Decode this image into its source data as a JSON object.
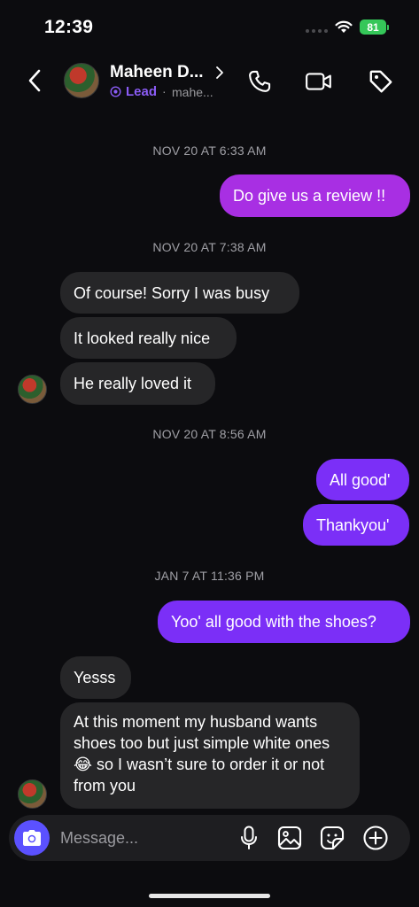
{
  "status_bar": {
    "time": "12:39",
    "battery": "81"
  },
  "header": {
    "contact_name": "Maheen D...",
    "lead_label": "Lead",
    "separator": "·",
    "username": "mahe..."
  },
  "conversation": {
    "timestamps": [
      "NOV 20 AT 6:33 AM",
      "NOV 20 AT 7:38 AM",
      "NOV 20 AT 8:56 AM",
      "JAN 7 AT 11:36 PM"
    ],
    "messages": [
      {
        "sender": "me",
        "text": "Do give us a review !!"
      },
      {
        "sender": "them",
        "text": "Of course! Sorry I was busy"
      },
      {
        "sender": "them",
        "text": "It looked really nice"
      },
      {
        "sender": "them",
        "text": "He really loved it"
      },
      {
        "sender": "me",
        "text": "All good'"
      },
      {
        "sender": "me",
        "text": "Thankyou'"
      },
      {
        "sender": "me",
        "text": "Yoo' all good with the shoes?"
      },
      {
        "sender": "them",
        "text": "Yesss"
      },
      {
        "sender": "them",
        "text": "At this moment my husband wants shoes too but just simple white ones😂 so I wasn’t sure to order it or not from you"
      }
    ]
  },
  "composer": {
    "placeholder": "Message..."
  },
  "colors": {
    "background": "#0c0c0f",
    "outgoing_bubble": "#7b2ff7",
    "outgoing_bubble_first": "#a82fe3",
    "incoming_bubble": "#262628",
    "camera_button": "#5b51ff",
    "lead_accent": "#8b5cf6",
    "battery": "#35c759"
  },
  "icons": [
    "signal-icon",
    "wifi-icon",
    "battery-icon",
    "back-icon",
    "chevron-right-icon",
    "lead-icon",
    "phone-icon",
    "video-camera-icon",
    "tag-icon",
    "camera-icon",
    "microphone-icon",
    "gallery-icon",
    "sticker-icon",
    "plus-icon"
  ]
}
